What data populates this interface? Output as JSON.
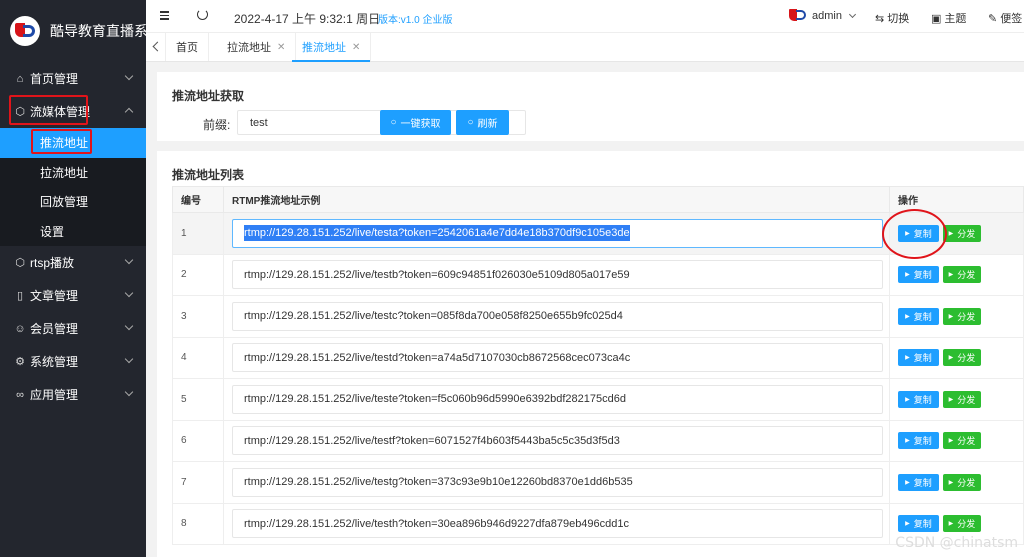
{
  "brand": {
    "title": "酷导教育直播系"
  },
  "sidebar": {
    "items": [
      {
        "label": "首页管理",
        "icon": "home-icon"
      },
      {
        "label": "流媒体管理",
        "icon": "cube-icon"
      },
      {
        "label": "rtsp播放",
        "icon": "cube-icon"
      },
      {
        "label": "文章管理",
        "icon": "document-icon"
      },
      {
        "label": "会员管理",
        "icon": "user-icon"
      },
      {
        "label": "系统管理",
        "icon": "gear-icon"
      },
      {
        "label": "应用管理",
        "icon": "link-icon"
      }
    ],
    "submenu": [
      {
        "label": "推流地址"
      },
      {
        "label": "拉流地址"
      },
      {
        "label": "回放管理"
      },
      {
        "label": "设置"
      }
    ]
  },
  "header": {
    "datetime": "2022-4-17 上午 9:32:1 周日",
    "version": "版本:v1.0 企业版",
    "user": "admin",
    "switch_label": "切换",
    "theme_label": "主题",
    "notes_label": "便签"
  },
  "tabs": [
    {
      "label": "首页"
    },
    {
      "label": "拉流地址"
    },
    {
      "label": "推流地址"
    }
  ],
  "fetch_panel": {
    "title": "推流地址获取",
    "prefix_label": "前缀:",
    "prefix_value": "test",
    "fetch_button": "一键获取",
    "refresh_button": "刷新"
  },
  "list_panel": {
    "title": "推流地址列表",
    "columns": [
      "编号",
      "RTMP推流地址示例",
      "操作"
    ],
    "copy_label": "复制",
    "distribute_label": "分发",
    "rows": [
      {
        "id": "1",
        "url": "rtmp://129.28.151.252/live/testa?token=2542061a4e7dd4e18b370df9c105e3de"
      },
      {
        "id": "2",
        "url": "rtmp://129.28.151.252/live/testb?token=609c94851f026030e5109d805a017e59"
      },
      {
        "id": "3",
        "url": "rtmp://129.28.151.252/live/testc?token=085f8da700e058f8250e655b9fc025d4"
      },
      {
        "id": "4",
        "url": "rtmp://129.28.151.252/live/testd?token=a74a5d7107030cb8672568cec073ca4c"
      },
      {
        "id": "5",
        "url": "rtmp://129.28.151.252/live/teste?token=f5c060b96d5990e6392bdf282175cd6d"
      },
      {
        "id": "6",
        "url": "rtmp://129.28.151.252/live/testf?token=6071527f4b603f5443ba5c5c35d3f5d3"
      },
      {
        "id": "7",
        "url": "rtmp://129.28.151.252/live/testg?token=373c93e9b10e12260bd8370e1dd6b535"
      },
      {
        "id": "8",
        "url": "rtmp://129.28.151.252/live/testh?token=30ea896b946d9227dfa879eb496cdd1c"
      }
    ]
  },
  "watermark": "CSDN @chinatsm",
  "colors": {
    "sidebar": "#23262e",
    "accent": "#1e9fff",
    "green": "#2cbd30",
    "annotation": "#e0141a"
  }
}
